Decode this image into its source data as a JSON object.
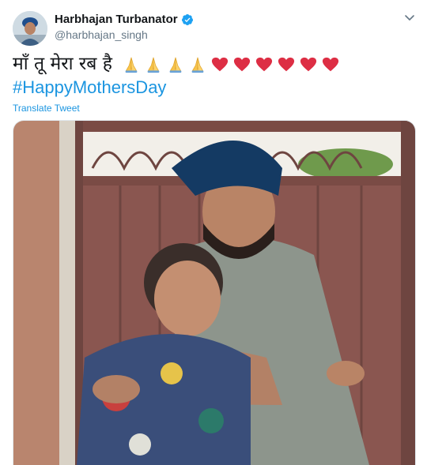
{
  "user": {
    "display_name": "Harbhajan Turbanator",
    "handle": "@harbhajan_singh"
  },
  "tweet": {
    "text": "माँ तू मेरा रब है",
    "emojis": [
      "folded-hands",
      "folded-hands",
      "folded-hands",
      "folded-hands",
      "red-heart",
      "red-heart",
      "red-heart",
      "red-heart",
      "red-heart",
      "red-heart"
    ],
    "hashtag": "#HappyMothersDay",
    "translate_label": "Translate Tweet"
  },
  "colors": {
    "link": "#1b95e0",
    "verified": "#1da1f2",
    "heart": "#e0245e",
    "secondary_text": "#657786"
  }
}
